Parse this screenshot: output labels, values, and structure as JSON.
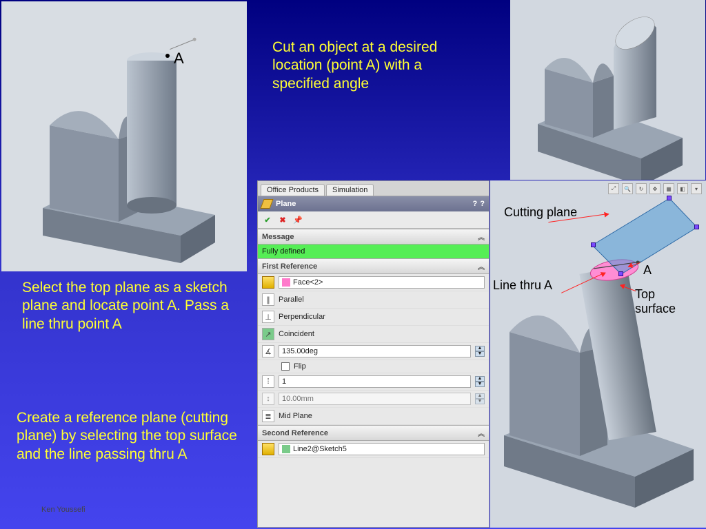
{
  "instructions": {
    "cut": "Cut an object at a desired location (point A) with a specified angle",
    "select": "Select the top plane as a sketch plane and locate point A. Pass a line thru point A",
    "create": "Create a reference plane (cutting plane) by selecting the top surface and the line passing thru A"
  },
  "labels": {
    "A_top": "A",
    "A_vp": "A",
    "cutting_plane": "Cutting plane",
    "line_thru_a": "Line thru A",
    "top_surface": "Top surface"
  },
  "author": "Ken Youssefi",
  "panel": {
    "tabs": {
      "office": "Office Products",
      "sim": "Simulation"
    },
    "title": "Plane",
    "message_head": "Message",
    "message_body": "Fully defined",
    "first_ref_head": "First Reference",
    "first_ref_val": "Face<2>",
    "opts": {
      "parallel": "Parallel",
      "perp": "Perpendicular",
      "coincident": "Coincident",
      "angle": "135.00deg",
      "flip": "Flip",
      "count": "1",
      "offset": "10.00mm",
      "midplane": "Mid Plane"
    },
    "second_ref_head": "Second Reference",
    "second_ref_val": "Line2@Sketch5"
  },
  "help": {
    "q": "?",
    "qq": "?"
  }
}
